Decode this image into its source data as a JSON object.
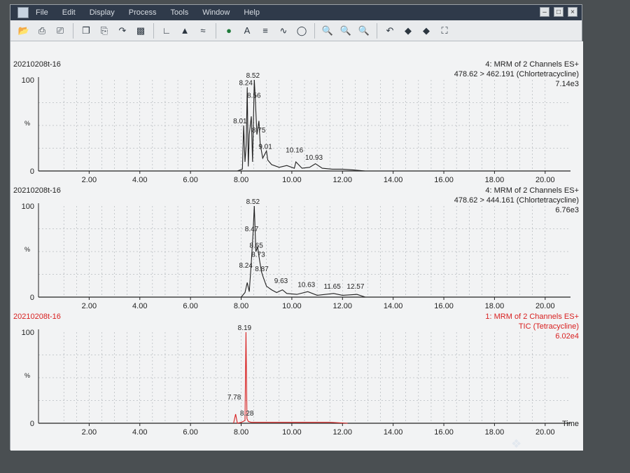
{
  "menu": {
    "items": [
      "File",
      "Edit",
      "Display",
      "Process",
      "Tools",
      "Window",
      "Help"
    ]
  },
  "window_controls": [
    "minimize",
    "maximize",
    "close"
  ],
  "toolbar": {
    "icons": [
      "open-icon",
      "print-icon",
      "print-preview-icon",
      "copy-icon",
      "paste-icon",
      "export-icon",
      "save-icon",
      "spectrum-icon",
      "peak-detect-icon",
      "chromatogram-icon",
      "integrate-icon",
      "label-icon",
      "subtract-icon",
      "smooth-icon",
      "refine-icon",
      "zoom-in-icon",
      "zoom-x-icon",
      "zoom-y-icon",
      "undo-zoom-icon",
      "pan-left-icon",
      "pan-right-icon",
      "fit-icon"
    ]
  },
  "colors": {
    "trace": "#202020",
    "trace_highlight": "#d82020",
    "grid": "#9aa0a6",
    "background": "#f2f3f4"
  },
  "chart_data": [
    {
      "type": "line",
      "sample": "20210208t-16",
      "title": "4: MRM of 2 Channels ES+",
      "transition": "478.62 > 462.191 (Chlortetracycline)",
      "intensity": "7.14e3",
      "ylabel": "%",
      "xlim": [
        0.0,
        21.0
      ],
      "ylim": [
        0,
        100
      ],
      "xticks": [
        "2.00",
        "4.00",
        "6.00",
        "8.00",
        "10.00",
        "12.00",
        "14.00",
        "16.00",
        "18.00",
        "20.00"
      ],
      "yticks": [
        "0",
        "100"
      ],
      "color": "#202020",
      "x": [
        7.85,
        8.05,
        8.1,
        8.15,
        8.2,
        8.24,
        8.28,
        8.32,
        8.4,
        8.45,
        8.52,
        8.56,
        8.62,
        8.7,
        8.75,
        8.85,
        9.0,
        9.05,
        9.2,
        9.5,
        9.8,
        10.1,
        10.16,
        10.4,
        10.7,
        10.93,
        11.2,
        11.6,
        12.0,
        12.5,
        12.9
      ],
      "y": [
        0,
        2,
        50,
        10,
        30,
        92,
        5,
        40,
        60,
        10,
        100,
        78,
        40,
        55,
        30,
        14,
        22,
        12,
        7,
        4,
        6,
        3,
        10,
        3,
        4,
        8,
        3,
        2,
        2,
        1,
        0
      ],
      "peak_labels": [
        {
          "x": 8.01,
          "y": 50,
          "text": "8.01"
        },
        {
          "x": 8.24,
          "y": 92,
          "text": "8.24"
        },
        {
          "x": 8.52,
          "y": 100,
          "text": "8.52"
        },
        {
          "x": 8.56,
          "y": 78,
          "text": "8.56"
        },
        {
          "x": 8.75,
          "y": 40,
          "text": "8.75"
        },
        {
          "x": 9.01,
          "y": 22,
          "text": "9.01"
        },
        {
          "x": 10.16,
          "y": 18,
          "text": "10.16"
        },
        {
          "x": 10.93,
          "y": 10,
          "text": "10.93"
        }
      ]
    },
    {
      "type": "line",
      "sample": "20210208t-16",
      "title": "4: MRM of 2 Channels ES+",
      "transition": "478.62 > 444.161 (Chlortetracycline)",
      "intensity": "6.76e3",
      "ylabel": "%",
      "xlim": [
        0.0,
        21.0
      ],
      "ylim": [
        0,
        100
      ],
      "xticks": [
        "2.00",
        "4.00",
        "6.00",
        "8.00",
        "10.00",
        "12.00",
        "14.00",
        "16.00",
        "18.00",
        "20.00"
      ],
      "yticks": [
        "0",
        "100"
      ],
      "color": "#202020",
      "x": [
        8.0,
        8.15,
        8.24,
        8.32,
        8.4,
        8.47,
        8.52,
        8.58,
        8.65,
        8.73,
        8.8,
        8.87,
        9.0,
        9.2,
        9.4,
        9.63,
        9.8,
        10.2,
        10.63,
        11.0,
        11.65,
        12.0,
        12.57,
        12.9
      ],
      "y": [
        0,
        5,
        16,
        6,
        38,
        70,
        100,
        50,
        55,
        40,
        28,
        22,
        12,
        8,
        5,
        8,
        4,
        3,
        6,
        2,
        4,
        2,
        3,
        0
      ],
      "peak_labels": [
        {
          "x": 8.24,
          "y": 30,
          "text": "8.24"
        },
        {
          "x": 8.47,
          "y": 70,
          "text": "8.47"
        },
        {
          "x": 8.52,
          "y": 100,
          "text": "8.52"
        },
        {
          "x": 8.65,
          "y": 52,
          "text": "8.65"
        },
        {
          "x": 8.73,
          "y": 42,
          "text": "8.73"
        },
        {
          "x": 8.87,
          "y": 26,
          "text": "8.87"
        },
        {
          "x": 9.63,
          "y": 13,
          "text": "9.63"
        },
        {
          "x": 10.63,
          "y": 9,
          "text": "10.63"
        },
        {
          "x": 11.65,
          "y": 7,
          "text": "11.65"
        },
        {
          "x": 12.57,
          "y": 7,
          "text": "12.57"
        }
      ]
    },
    {
      "type": "line",
      "sample": "20210208t-16",
      "title": "1: MRM of 2 Channels ES+",
      "transition": "TIC (Tetracycline)",
      "intensity": "6.02e4",
      "ylabel": "%",
      "xlabel": "Time",
      "xlim": [
        0.0,
        21.0
      ],
      "ylim": [
        0,
        100
      ],
      "xticks": [
        "2.00",
        "4.00",
        "6.00",
        "8.00",
        "10.00",
        "12.00",
        "14.00",
        "16.00",
        "18.00",
        "20.00"
      ],
      "yticks": [
        "0",
        "100"
      ],
      "color": "#d82020",
      "x": [
        7.7,
        7.78,
        7.85,
        8.0,
        8.15,
        8.19,
        8.23,
        8.28,
        8.4,
        8.8,
        9.5,
        10.5,
        11.5,
        12.2
      ],
      "y": [
        0,
        10,
        0,
        1,
        3,
        100,
        5,
        2,
        1,
        1,
        1,
        1,
        1,
        0
      ],
      "peak_labels": [
        {
          "x": 7.78,
          "y": 24,
          "text": "7.78"
        },
        {
          "x": 8.19,
          "y": 100,
          "text": "8.19"
        },
        {
          "x": 8.28,
          "y": 6,
          "text": "8.28"
        }
      ]
    }
  ]
}
